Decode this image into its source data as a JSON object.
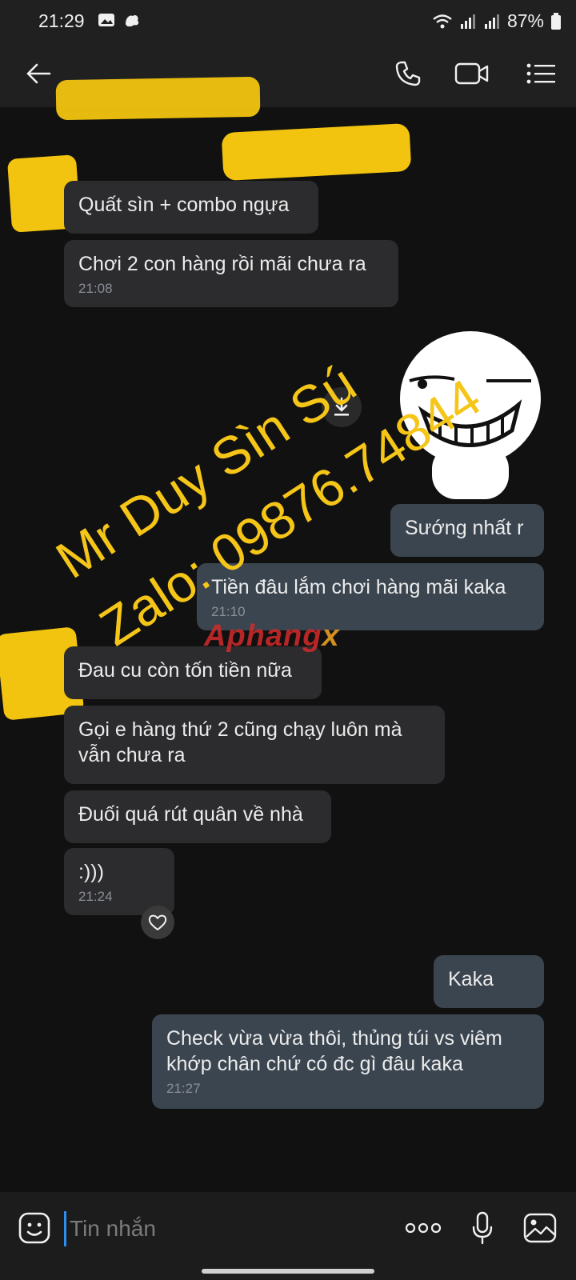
{
  "status_bar": {
    "time": "21:29",
    "battery": "87%"
  },
  "header": {
    "contact_name": ""
  },
  "messages": [
    {
      "direction": "in",
      "text": "Quất sìn + combo ngựa",
      "time": ""
    },
    {
      "direction": "in",
      "text": "Chơi 2 con hàng rồi mãi chưa ra",
      "time": "21:08"
    },
    {
      "direction": "out",
      "text": "Sướng nhất r",
      "time": ""
    },
    {
      "direction": "out",
      "text": "Tiền đâu lắm chơi hàng mãi kaka",
      "time": "21:10"
    },
    {
      "direction": "in",
      "text": "Đau cu còn tốn tiền nữa",
      "time": ""
    },
    {
      "direction": "in",
      "text": "Gọi e hàng thứ 2 cũng chạy luôn mà vẫn chưa ra",
      "time": ""
    },
    {
      "direction": "in",
      "text": "Đuối quá rút quân về nhà",
      "time": ""
    },
    {
      "direction": "in",
      "text": ":)))",
      "time": "21:24"
    },
    {
      "direction": "out",
      "text": "Kaka",
      "time": ""
    },
    {
      "direction": "out",
      "text": "Check vừa vừa thôi, thủng túi vs viêm khớp chân chứ có đc gì đâu kaka",
      "time": "21:27"
    }
  ],
  "watermark": {
    "line1": "Mr Duy Sìn Sú",
    "line2": "Zalo: 09876.74844",
    "brand_main": "Aphang",
    "brand_x": "x"
  },
  "input": {
    "placeholder": "Tin nhắn"
  },
  "colors": {
    "background": "#111111",
    "incoming_bubble": "#2c2c2e",
    "outgoing_bubble": "#3b4550",
    "watermark": "#f5c518",
    "redaction": "#f2c40f"
  }
}
